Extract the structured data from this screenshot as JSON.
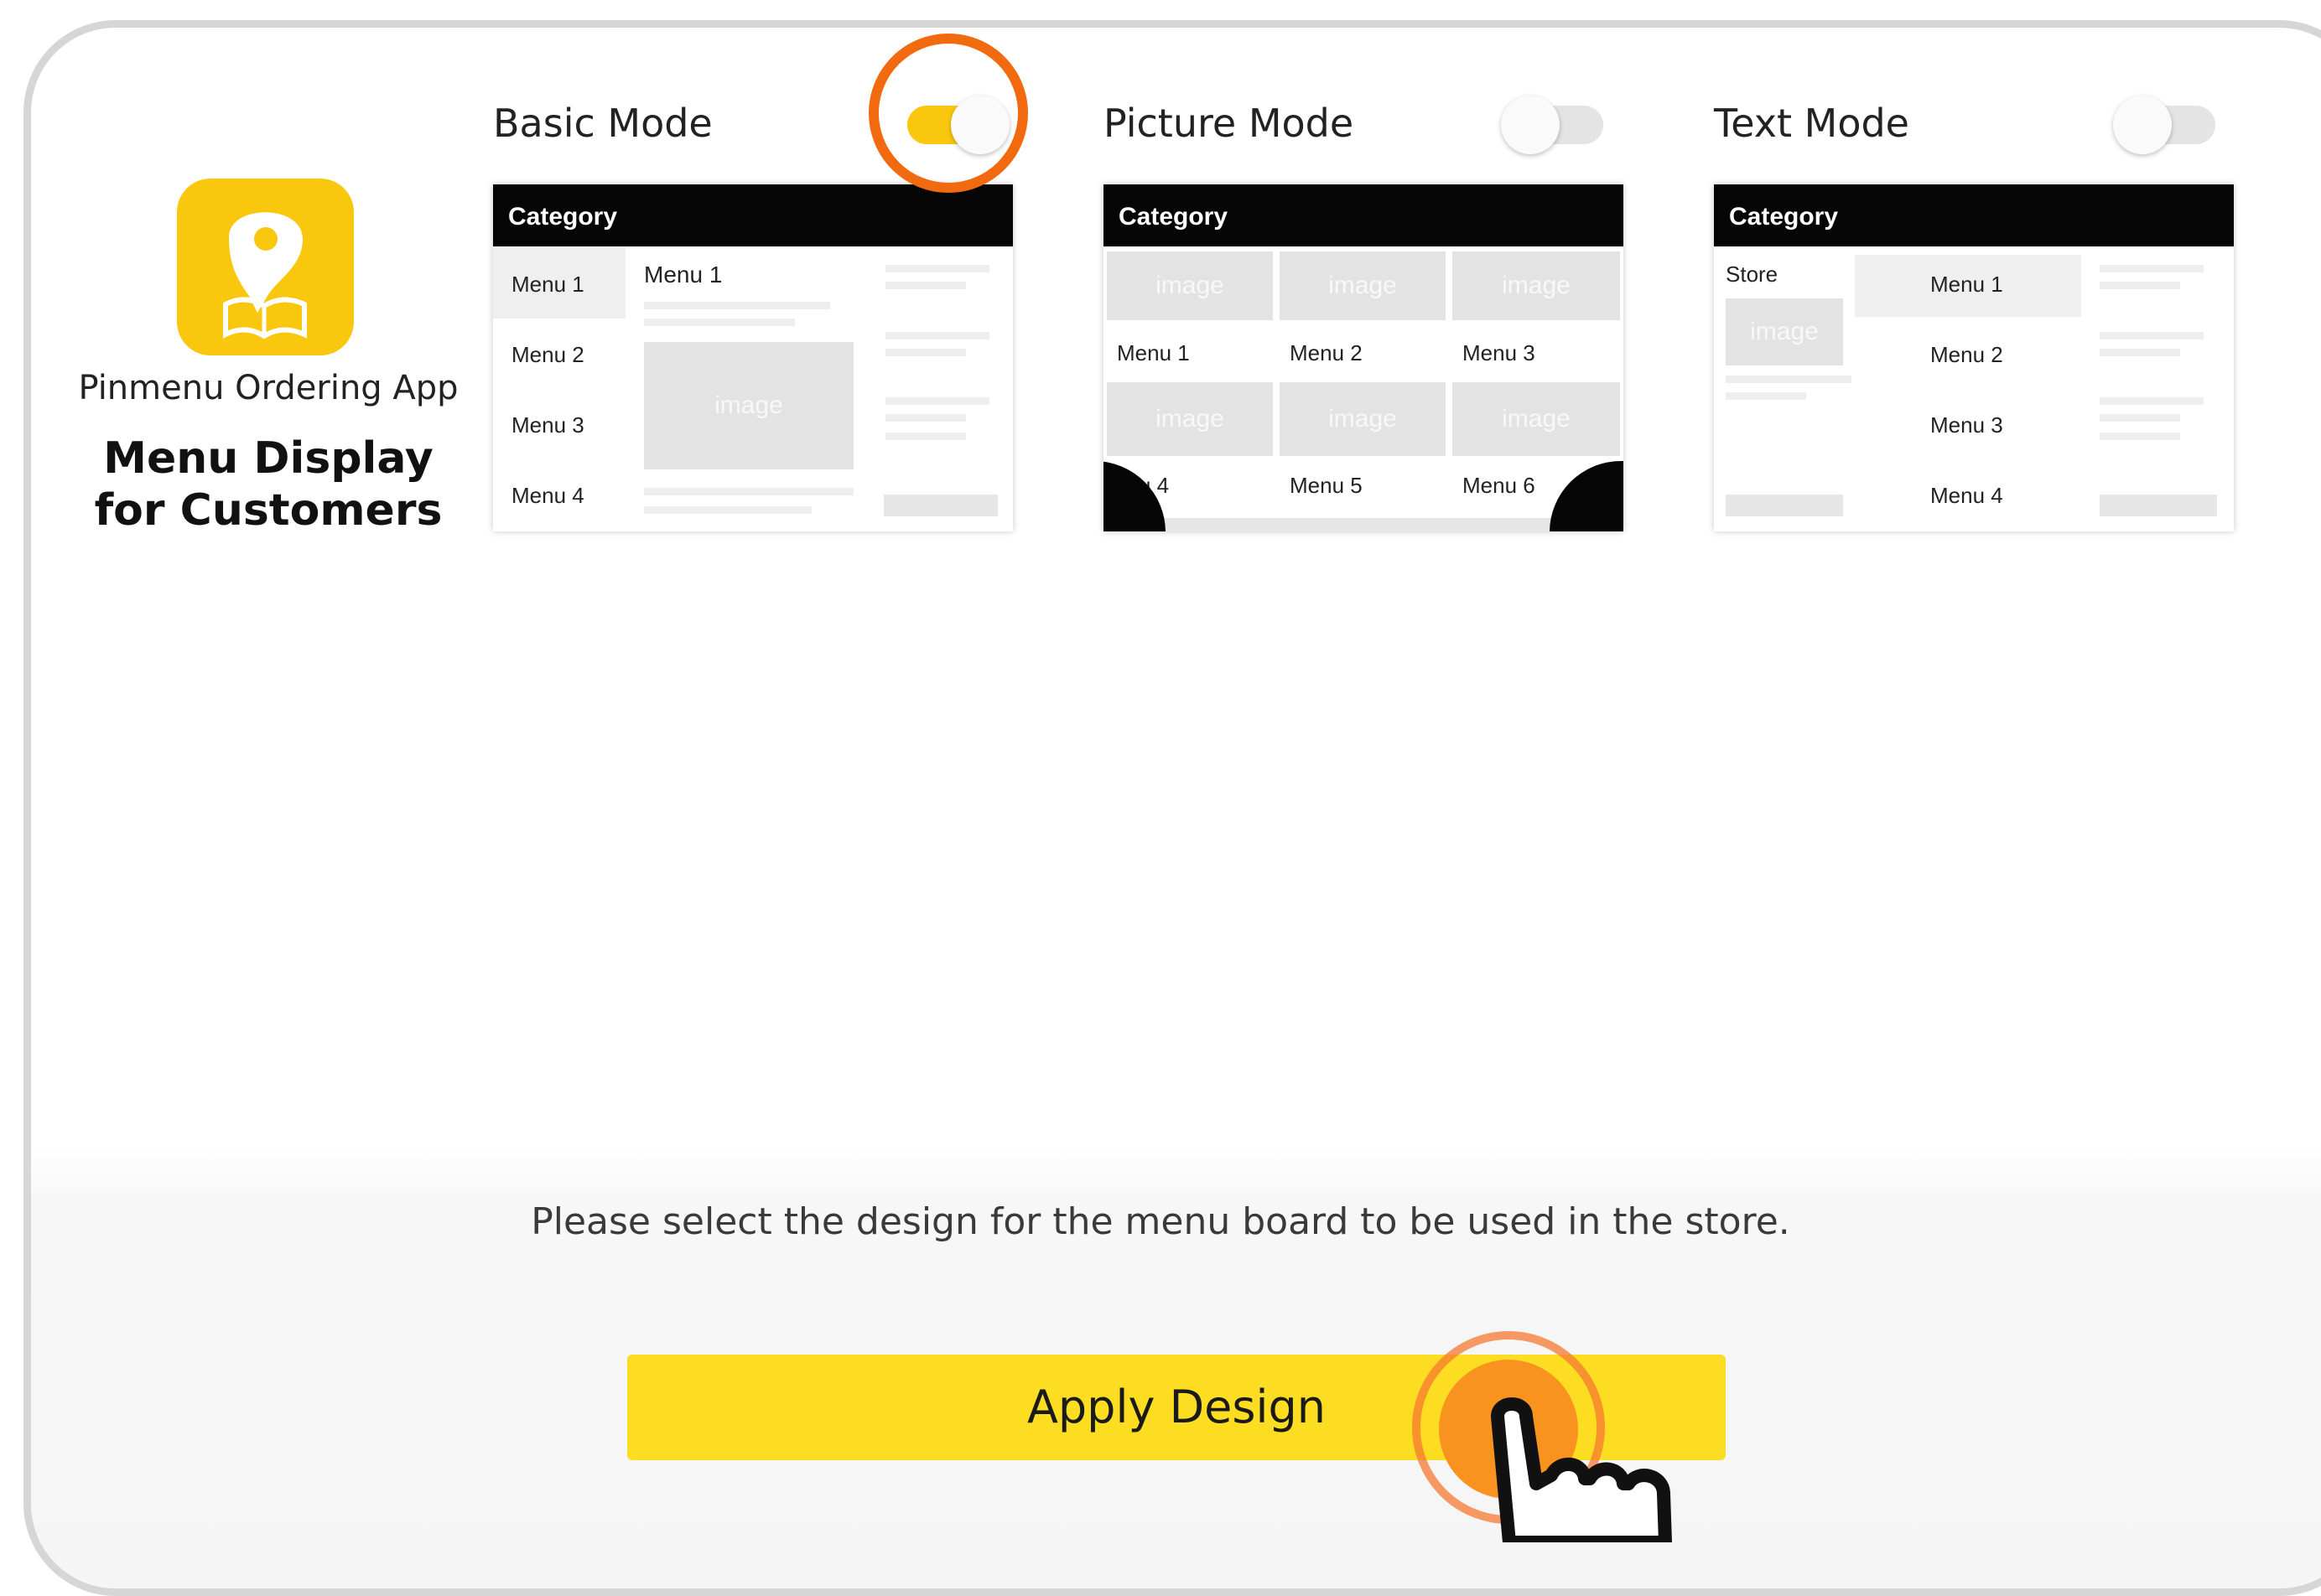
{
  "app": {
    "name": "Pinmenu Ordering App",
    "title_line1": "Menu Display",
    "title_line2": "for Customers",
    "icon": "pinmenu-logo-icon"
  },
  "modes": {
    "basic": {
      "label": "Basic Mode",
      "enabled": true,
      "preview": {
        "header": "Category",
        "menu_items": [
          "Menu 1",
          "Menu 2",
          "Menu 3",
          "Menu 4"
        ],
        "detail_title": "Menu 1",
        "image_label": "image"
      }
    },
    "picture": {
      "label": "Picture Mode",
      "enabled": false,
      "preview": {
        "header": "Category",
        "image_label": "image",
        "row1": [
          "Menu 1",
          "Menu 2",
          "Menu 3"
        ],
        "row2": [
          "u 4",
          "Menu 5",
          "Menu 6"
        ]
      }
    },
    "text": {
      "label": "Text Mode",
      "enabled": false,
      "preview": {
        "header": "Category",
        "store_label": "Store",
        "image_label": "image",
        "menu_items": [
          "Menu 1",
          "Menu 2",
          "Menu 3",
          "Menu 4"
        ]
      }
    }
  },
  "instruction": "Please select the design for the menu board to be used in the store.",
  "apply_button": "Apply Design",
  "colors": {
    "accent_yellow": "#f9c80e",
    "button_yellow": "#fddd21",
    "highlight_orange": "#f26a0f",
    "header_black": "#050505"
  }
}
